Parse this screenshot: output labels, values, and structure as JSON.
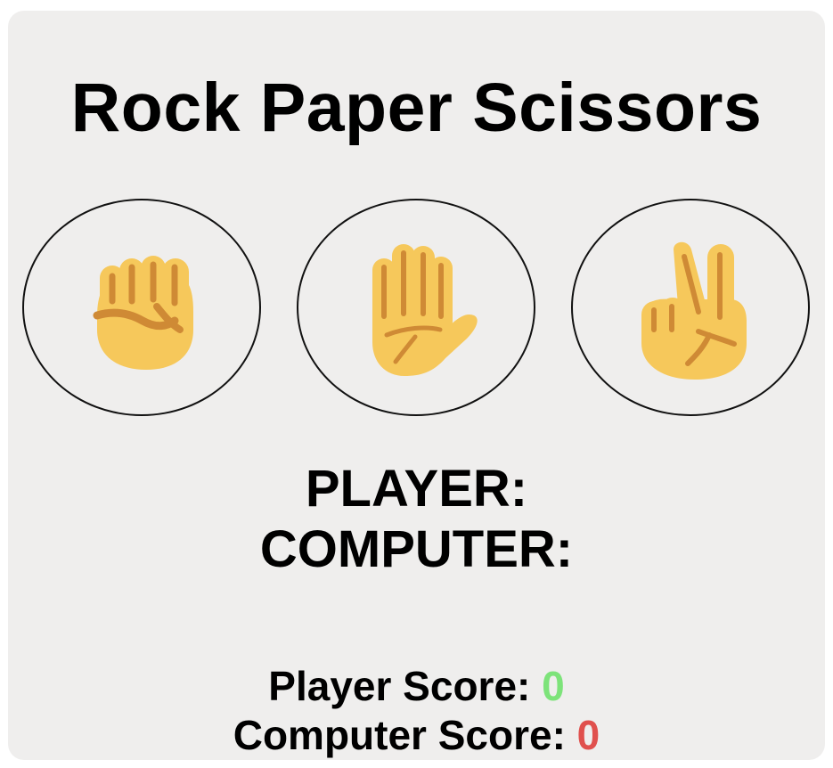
{
  "game": {
    "title": "Rock Paper Scissors",
    "choices": [
      {
        "name": "rock",
        "icon": "raised-fist-icon"
      },
      {
        "name": "paper",
        "icon": "raised-hand-icon"
      },
      {
        "name": "scissors",
        "icon": "victory-hand-icon"
      }
    ],
    "player_choice_label": "PLAYER:",
    "player_choice_value": "",
    "computer_choice_label": "COMPUTER:",
    "computer_choice_value": "",
    "player_score_label": "Player Score: ",
    "player_score": "0",
    "computer_score_label": "Computer Score: ",
    "computer_score": "0"
  },
  "colors": {
    "background": "#efeeed",
    "player_score": "#7de37a",
    "computer_score": "#e0504d",
    "emoji_skin": "#f6c85b",
    "emoji_shade": "#cf8a35"
  }
}
